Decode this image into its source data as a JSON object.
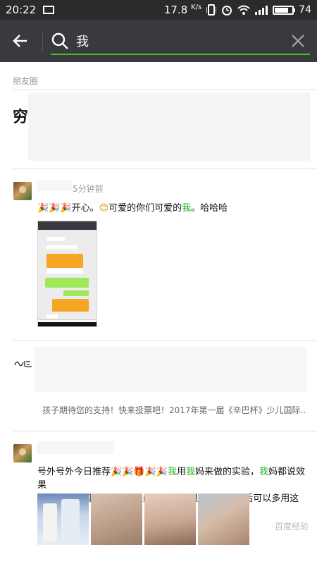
{
  "status_bar": {
    "time": "20:22",
    "speed": "17.8",
    "speed_unit": "K/s",
    "battery": "74"
  },
  "search": {
    "query": "我"
  },
  "section_moments": {
    "label": "朋友圈"
  },
  "top_result": {
    "text": "穷"
  },
  "post1": {
    "time": "5分钟前",
    "text_prefix": "开心。",
    "text_mid": "可爱的你们可爱的",
    "highlight": "我",
    "text_suffix": "。哈哈哈"
  },
  "post2": {
    "link_text": "孩子期待您的支持！快来投票吧！2017年第一届《辛巴杯》少儿国际..."
  },
  "post3": {
    "line1_a": "号外号外今日推荐",
    "hl1": "我",
    "line1_b": "用",
    "hl2": "我",
    "line1_c": "妈来做的实验，",
    "hl3": "我",
    "line1_d": "妈都说效果",
    "line2": "不错。[耶][耶]有一股淡淡的奶香味，很自然还说以后可以多用这个。..."
  },
  "watermark": "百度经验",
  "colors": {
    "accent": "#45c01a",
    "highlight": "#1aad19",
    "header_bg": "#393a3f"
  }
}
